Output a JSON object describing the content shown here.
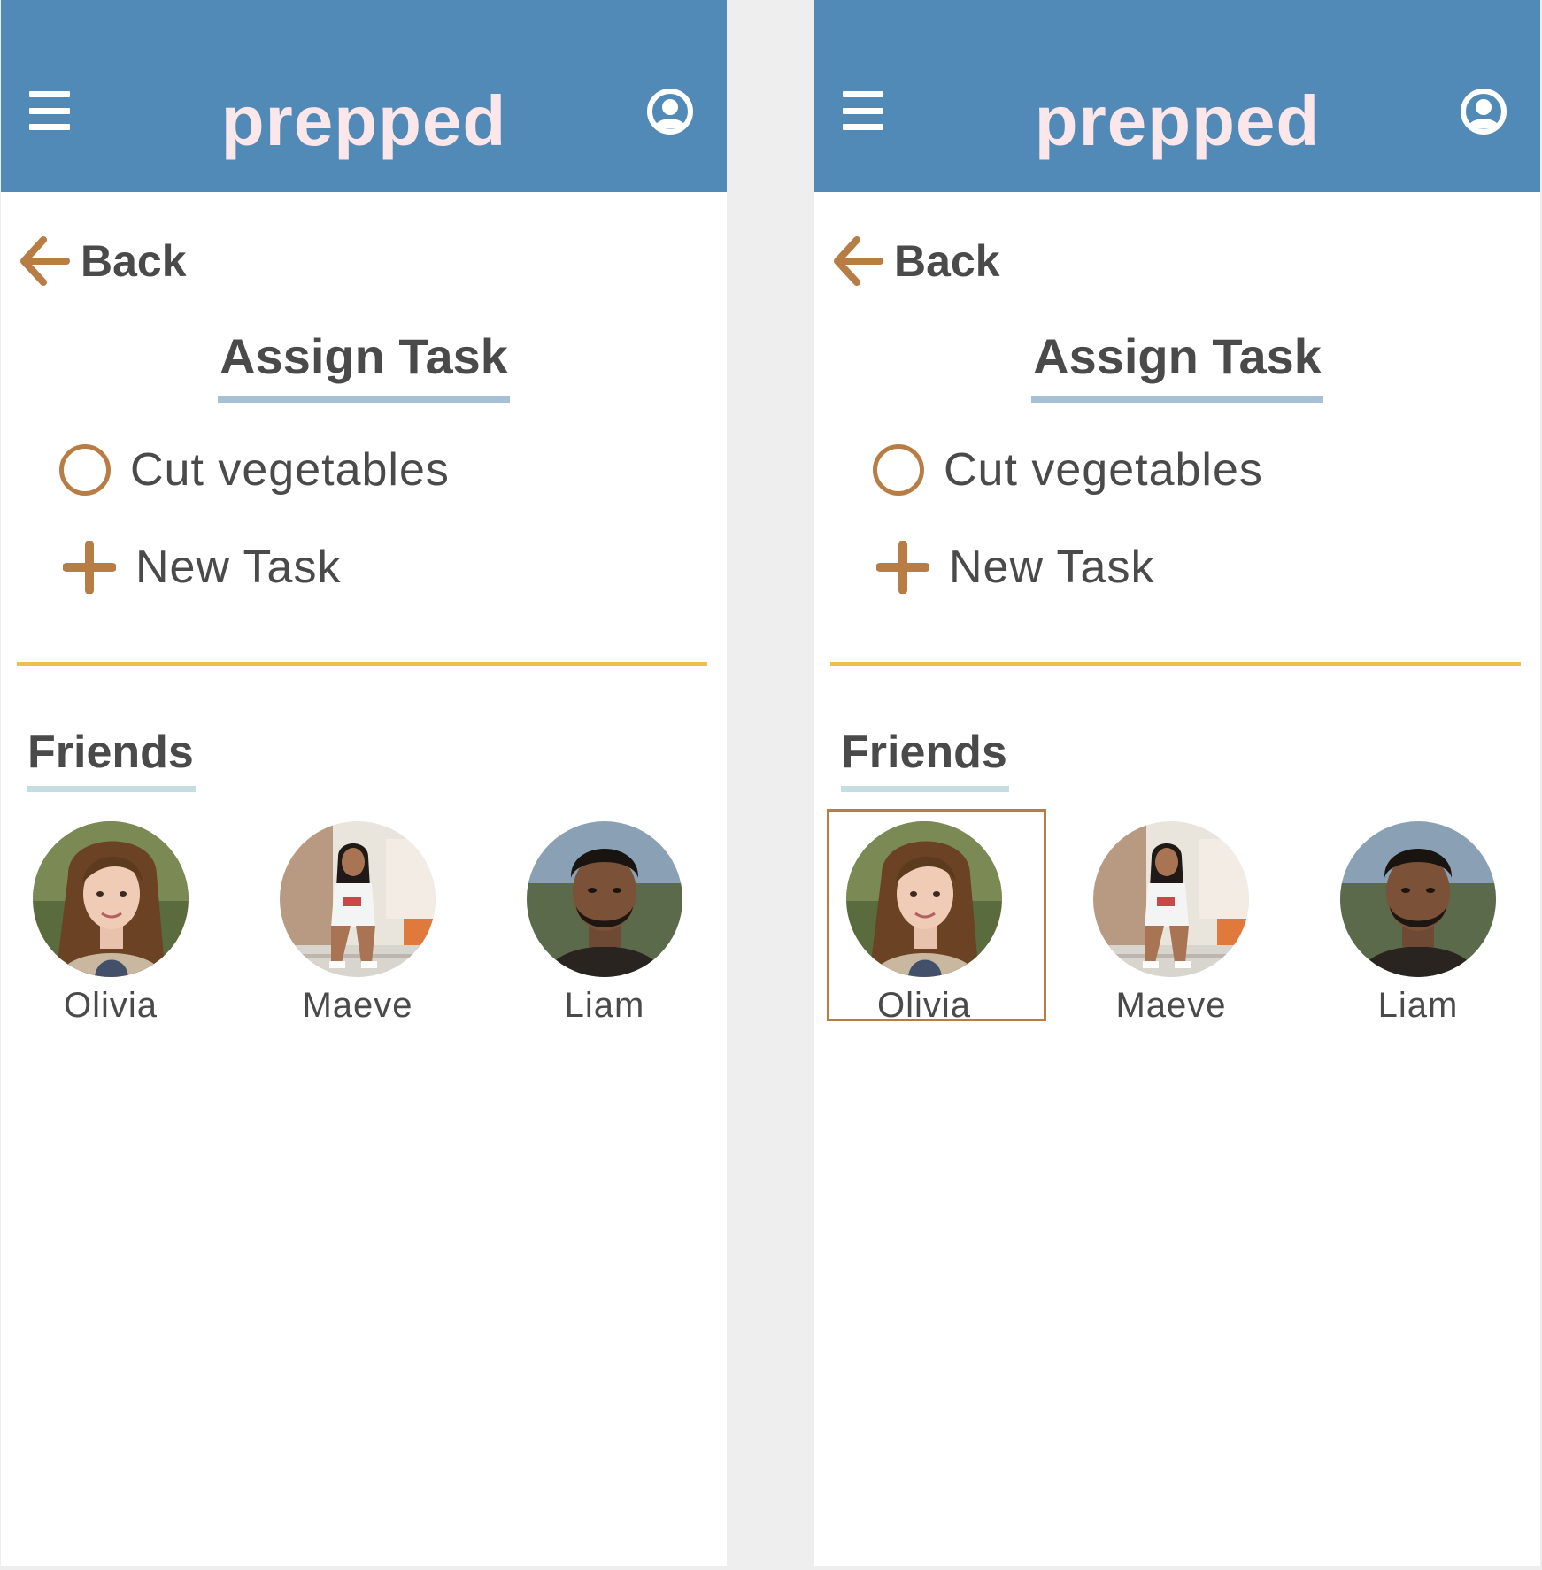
{
  "screens": [
    {
      "app_title": "prepped",
      "back_label": "Back",
      "section_title": "Assign Task",
      "tasks": [
        {
          "label": "Cut vegetables",
          "checked": false
        }
      ],
      "new_task_label": "New Task",
      "friends_title": "Friends",
      "friends": [
        {
          "name": "Olivia",
          "selected": false
        },
        {
          "name": "Maeve",
          "selected": false
        },
        {
          "name": "Liam",
          "selected": false
        }
      ]
    },
    {
      "app_title": "prepped",
      "back_label": "Back",
      "section_title": "Assign Task",
      "tasks": [
        {
          "label": "Cut vegetables",
          "checked": false
        }
      ],
      "new_task_label": "New Task",
      "friends_title": "Friends",
      "friends": [
        {
          "name": "Olivia",
          "selected": true
        },
        {
          "name": "Maeve",
          "selected": false
        },
        {
          "name": "Liam",
          "selected": false
        }
      ]
    }
  ],
  "colors": {
    "header": "#528ab7",
    "logo": "#fbe7ea",
    "accent": "#b87d45",
    "divider": "#efbf4e",
    "title_underline": "#a6c0d6",
    "friends_underline": "#c3dde3",
    "text": "#4a4a4a"
  },
  "icons": {
    "menu": "hamburger-icon",
    "account": "user-circle-icon",
    "back": "arrow-left-icon",
    "task": "radio-circle-icon",
    "add": "plus-icon"
  }
}
